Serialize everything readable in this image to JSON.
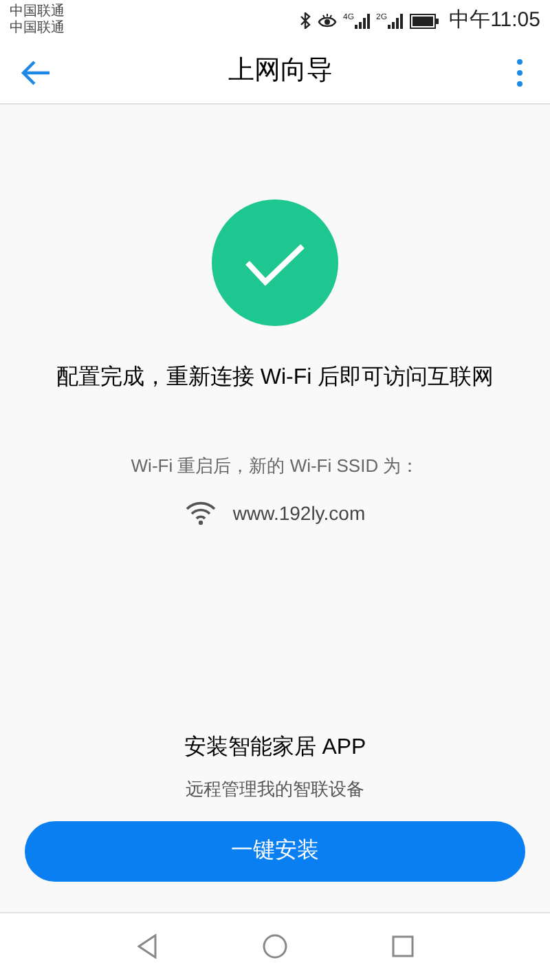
{
  "status_bar": {
    "carriers": [
      "中国联通",
      "中国联通"
    ],
    "signals": [
      "4G",
      "2G"
    ],
    "time": "中午11:05"
  },
  "header": {
    "title": "上网向导"
  },
  "result": {
    "message": "配置完成，重新连接 Wi-Fi 后即可访问互联网",
    "ssid_label": "Wi-Fi 重启后，新的 Wi-Fi SSID 为：",
    "ssid": "www.192ly.com"
  },
  "app_promo": {
    "title": "安装智能家居 APP",
    "subtitle": "远程管理我的智联设备",
    "button": "一键安装"
  }
}
